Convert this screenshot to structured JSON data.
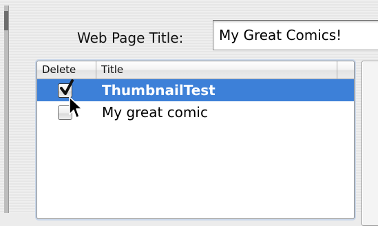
{
  "form": {
    "title_label": "Web Page Title:",
    "title_value": "My Great Comics!"
  },
  "table": {
    "columns": [
      "Delete",
      "Title"
    ],
    "rows": [
      {
        "delete": true,
        "title": "ThumbnailTest",
        "selected": true
      },
      {
        "delete": false,
        "title": "My great comic",
        "selected": false
      }
    ]
  },
  "colors": {
    "selection": "#3d80d8",
    "focus_ring": "#c9d7ea"
  },
  "icons": {
    "cursor": "arrow-pointer-icon",
    "check": "checkmark-icon"
  }
}
